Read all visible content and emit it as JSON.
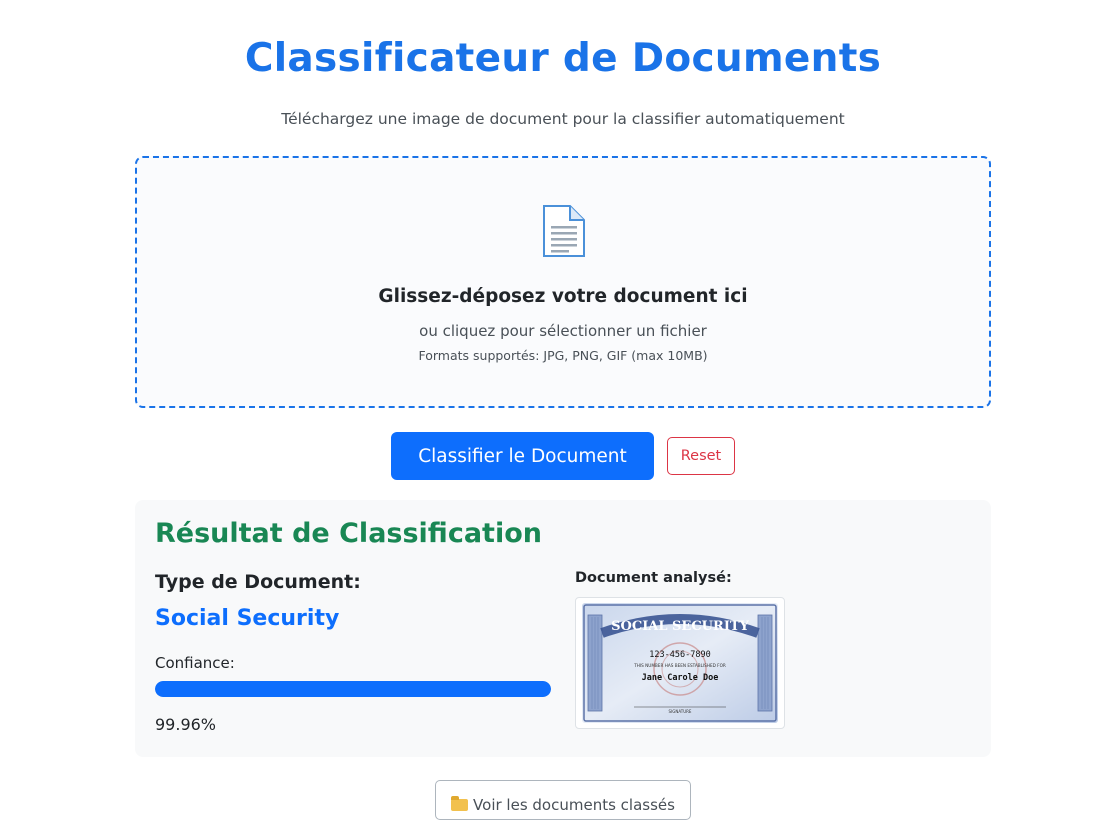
{
  "header": {
    "title": "Classificateur de Documents",
    "subtitle": "Téléchargez une image de document pour la classifier automatiquement"
  },
  "dropzone": {
    "icon": "document-icon",
    "title": "Glissez-déposez votre document ici",
    "subtitle": "ou cliquez pour sélectionner un fichier",
    "formats": "Formats supportés: JPG, PNG, GIF (max 10MB)"
  },
  "actions": {
    "classify_label": "Classifier le Document",
    "reset_label": "Reset"
  },
  "result": {
    "title": "Résultat de Classification",
    "doc_type_label": "Type de Document:",
    "doc_type_value": "Social Security",
    "confidence_label": "Confiance:",
    "confidence_value": "99.96%",
    "confidence_fraction": 0.9996,
    "analyzed_label": "Document analysé:",
    "card": {
      "header": "SOCIAL SECURITY",
      "number": "123-456-7890",
      "established_text": "THIS NUMBER HAS BEEN ESTABLISHED FOR",
      "name": "Jane Carole Doe",
      "signature_label": "SIGNATURE"
    }
  },
  "footer": {
    "view_docs_label": "Voir les documents classés",
    "view_docs_icon": "folder-icon"
  },
  "colors": {
    "primary": "#0d6efd",
    "title_blue": "#1a73e8",
    "success": "#198754",
    "danger": "#dc3545"
  }
}
